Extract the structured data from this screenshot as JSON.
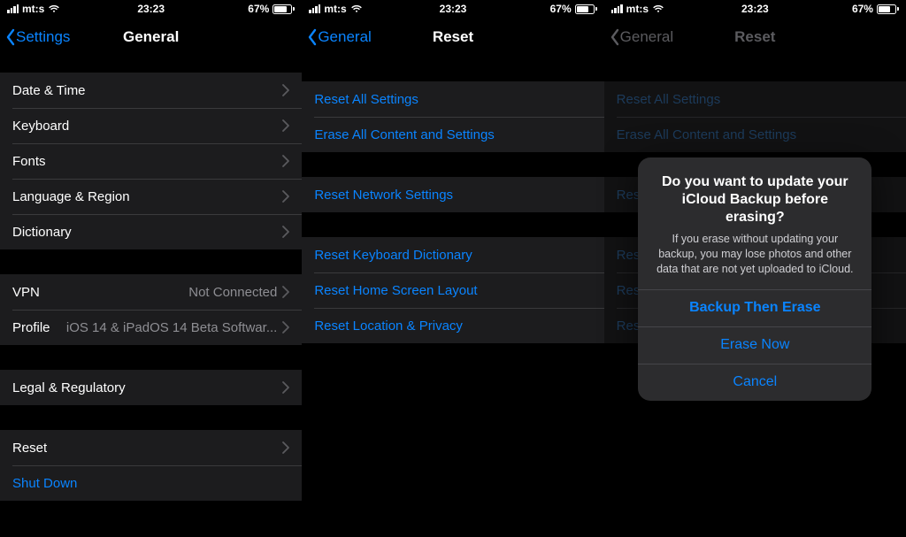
{
  "status": {
    "carrier": "mt:s",
    "time": "23:23",
    "battery_pct": "67%",
    "battery_fill_pct": 67
  },
  "panel1": {
    "nav_back": "Settings",
    "nav_title": "General",
    "groupA": [
      {
        "label": "Date & Time"
      },
      {
        "label": "Keyboard"
      },
      {
        "label": "Fonts"
      },
      {
        "label": "Language & Region"
      },
      {
        "label": "Dictionary"
      }
    ],
    "groupB": [
      {
        "label": "VPN",
        "value": "Not Connected"
      },
      {
        "label": "Profile",
        "value": "iOS 14 & iPadOS 14 Beta Softwar..."
      }
    ],
    "groupC": [
      {
        "label": "Legal & Regulatory"
      }
    ],
    "groupD": [
      {
        "label": "Reset"
      },
      {
        "label": "Shut Down"
      }
    ]
  },
  "panel2": {
    "nav_back": "General",
    "nav_title": "Reset",
    "groupA": [
      {
        "label": "Reset All Settings"
      },
      {
        "label": "Erase All Content and Settings"
      }
    ],
    "groupB": [
      {
        "label": "Reset Network Settings"
      }
    ],
    "groupC": [
      {
        "label": "Reset Keyboard Dictionary"
      },
      {
        "label": "Reset Home Screen Layout"
      },
      {
        "label": "Reset Location & Privacy"
      }
    ]
  },
  "panel3": {
    "nav_back": "General",
    "nav_title": "Reset",
    "dialog": {
      "title": "Do you want to update your iCloud Backup before erasing?",
      "message": "If you erase without updating your backup, you may lose photos and other data that are not yet uploaded to iCloud.",
      "primary": "Backup Then Erase",
      "secondary": "Erase Now",
      "cancel": "Cancel"
    }
  }
}
